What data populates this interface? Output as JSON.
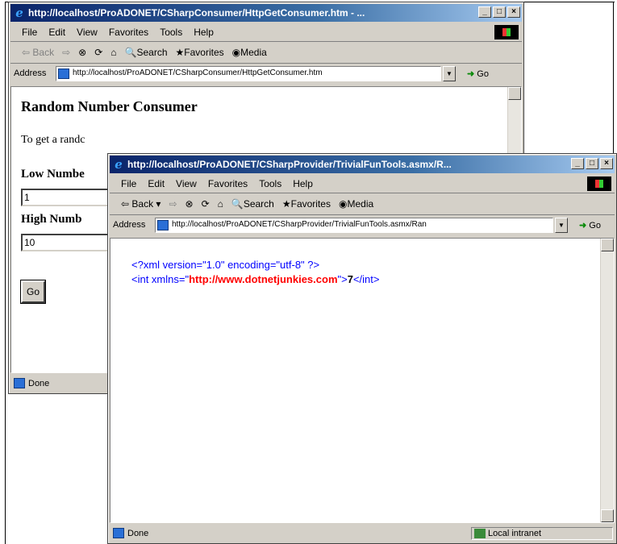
{
  "back_window": {
    "title": "http://localhost/ProADONET/CSharpConsumer/HttpGetConsumer.htm - ...",
    "menu": [
      "File",
      "Edit",
      "View",
      "Favorites",
      "Tools",
      "Help"
    ],
    "toolbar": {
      "back": "Back",
      "search": "Search",
      "favorites": "Favorites",
      "media": "Media"
    },
    "address_label": "Address",
    "address_value": "http://localhost/ProADONET/CSharpConsumer/HttpGetConsumer.htm",
    "go_label": "Go",
    "page": {
      "heading": "Random Number Consumer",
      "intro": "To get a randc",
      "low_label": "Low Numbe",
      "low_value": "1",
      "high_label": "High Numb",
      "high_value": "10",
      "go_button": "Go"
    },
    "status": "Done"
  },
  "front_window": {
    "title": "http://localhost/ProADONET/CSharpProvider/TrivialFunTools.asmx/R...",
    "menu": [
      "File",
      "Edit",
      "View",
      "Favorites",
      "Tools",
      "Help"
    ],
    "toolbar": {
      "back": "Back",
      "search": "Search",
      "favorites": "Favorites",
      "media": "Media"
    },
    "address_label": "Address",
    "address_value": "http://localhost/ProADONET/CSharpProvider/TrivialFunTools.asmx/Ran",
    "go_label": "Go",
    "xml": {
      "line1": "<?xml version=\"1.0\" encoding=\"utf-8\" ?>",
      "open_tag": "<int xmlns=\"",
      "namespace": "http://www.dotnetjunkies.com",
      "after_ns": "\">",
      "value": "7",
      "close_tag": "</int>"
    },
    "status": "Done",
    "zone": "Local intranet"
  }
}
